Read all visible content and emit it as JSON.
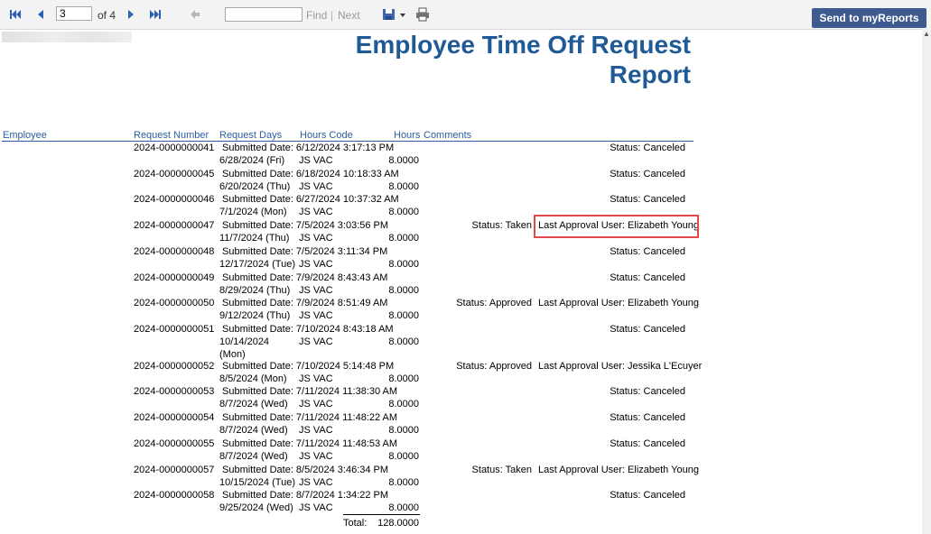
{
  "toolbar": {
    "page_value": "3",
    "of_text": "of 4",
    "find_label": "Find",
    "separator": "|",
    "next_label": "Next",
    "send_label": "Send to myReports"
  },
  "report": {
    "title_line1": "Employee Time Off Request",
    "title_line2": "Report",
    "columns": {
      "employee": "Employee",
      "request_number": "Request Number",
      "request_days": "Request Days",
      "hours_code": "Hours Code",
      "hours": "Hours",
      "comments": "Comments"
    },
    "requests": [
      {
        "number": "2024-0000000041",
        "submitted": "Submitted Date: 6/12/2024 3:17:13 PM",
        "status": "Status: Canceled",
        "approval": "",
        "date": "6/28/2024 (Fri)",
        "code": "JS VAC",
        "hours": "8.0000"
      },
      {
        "number": "2024-0000000045",
        "submitted": "Submitted Date: 6/18/2024 10:18:33 AM",
        "status": "Status: Canceled",
        "approval": "",
        "date": "6/20/2024 (Thu)",
        "code": "JS VAC",
        "hours": "8.0000"
      },
      {
        "number": "2024-0000000046",
        "submitted": "Submitted Date: 6/27/2024 10:37:32 AM",
        "status": "Status: Canceled",
        "approval": "",
        "date": "7/1/2024 (Mon)",
        "code": "JS VAC",
        "hours": "8.0000"
      },
      {
        "number": "2024-0000000047",
        "submitted": "Submitted Date: 7/5/2024 3:03:56 PM",
        "status": "Status: Taken",
        "approval": "Last Approval User: Elizabeth Young",
        "date": "11/7/2024 (Thu)",
        "code": "JS VAC",
        "hours": "8.0000"
      },
      {
        "number": "2024-0000000048",
        "submitted": "Submitted Date: 7/5/2024 3:11:34 PM",
        "status": "Status: Canceled",
        "approval": "",
        "date": "12/17/2024 (Tue)",
        "code": "JS VAC",
        "hours": "8.0000"
      },
      {
        "number": "2024-0000000049",
        "submitted": "Submitted Date: 7/9/2024 8:43:43 AM",
        "status": "Status: Canceled",
        "approval": "",
        "date": "8/29/2024 (Thu)",
        "code": "JS VAC",
        "hours": "8.0000"
      },
      {
        "number": "2024-0000000050",
        "submitted": "Submitted Date: 7/9/2024 8:51:49 AM",
        "status": "Status: Approved",
        "approval": "Last Approval User: Elizabeth Young",
        "date": "9/12/2024 (Thu)",
        "code": "JS VAC",
        "hours": "8.0000"
      },
      {
        "number": "2024-0000000051",
        "submitted": "Submitted Date: 7/10/2024 8:43:18 AM",
        "status": "Status: Canceled",
        "approval": "",
        "date": "10/14/2024",
        "date2": "(Mon)",
        "code": "JS VAC",
        "hours": "8.0000"
      },
      {
        "number": "2024-0000000052",
        "submitted": "Submitted Date: 7/10/2024 5:14:48 PM",
        "status": "Status: Approved",
        "approval": "Last Approval User: Jessika L'Ecuyer",
        "date": "8/5/2024 (Mon)",
        "code": "JS VAC",
        "hours": "8.0000"
      },
      {
        "number": "2024-0000000053",
        "submitted": "Submitted Date: 7/11/2024 11:38:30 AM",
        "status": "Status: Canceled",
        "approval": "",
        "date": "8/7/2024 (Wed)",
        "code": "JS VAC",
        "hours": "8.0000"
      },
      {
        "number": "2024-0000000054",
        "submitted": "Submitted Date: 7/11/2024 11:48:22 AM",
        "status": "Status: Canceled",
        "approval": "",
        "date": "8/7/2024 (Wed)",
        "code": "JS VAC",
        "hours": "8.0000"
      },
      {
        "number": "2024-0000000055",
        "submitted": "Submitted Date: 7/11/2024 11:48:53 AM",
        "status": "Status: Canceled",
        "approval": "",
        "date": "8/7/2024 (Wed)",
        "code": "JS VAC",
        "hours": "8.0000"
      },
      {
        "number": "2024-0000000057",
        "submitted": "Submitted Date: 8/5/2024 3:46:34 PM",
        "status": "Status: Taken",
        "approval": "Last Approval User: Elizabeth Young",
        "date": "10/15/2024 (Tue)",
        "code": "JS VAC",
        "hours": "8.0000"
      },
      {
        "number": "2024-0000000058",
        "submitted": "Submitted Date: 8/7/2024 1:34:22 PM",
        "status": "Status: Canceled",
        "approval": "",
        "date": "9/25/2024 (Wed)",
        "code": "JS VAC",
        "hours": "8.0000"
      }
    ],
    "total_label": "Total:",
    "total_value": "128.0000"
  }
}
